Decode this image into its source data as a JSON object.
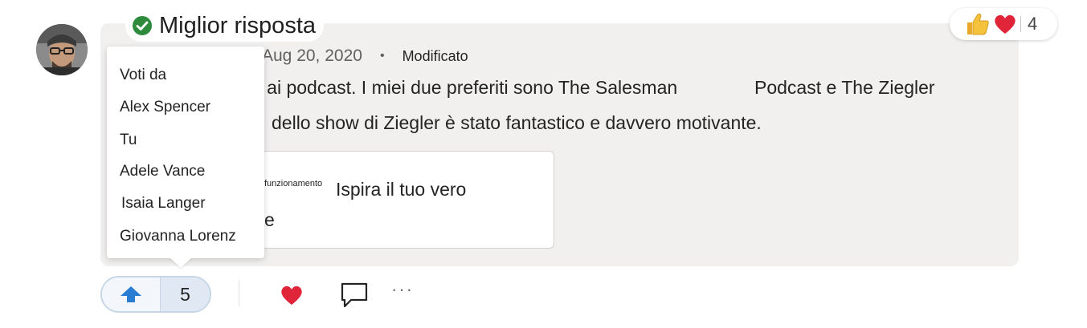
{
  "post": {
    "best_answer_label": "Miglior risposta",
    "date": "Aug 20, 2020",
    "separator": "•",
    "edited_label": "Modificato",
    "body_line1_left": "g ai podcast. I miei due preferiti sono The Salesman",
    "body_line1_right": "Podcast e The Ziegler",
    "body_line2": "dello show di Ziegler è stato fantastico e davvero motivante.",
    "link_card": {
      "small_text": "funzionamento",
      "title_line1": "Ispira il tuo vero",
      "title_line2": "e"
    }
  },
  "reactions": {
    "count": "4",
    "icons": [
      "thumbs-up-icon",
      "heart-icon"
    ]
  },
  "voters_popup": {
    "header": "Voti da",
    "names": [
      "Alex Spencer",
      "Tu",
      "Adele Vance",
      "Isaia Langer",
      "Giovanna  Lorenz"
    ]
  },
  "actions": {
    "upvote_count": "5",
    "more_label": "···"
  },
  "colors": {
    "upvote_blue": "#2b7cd3",
    "heart_red": "#e0243a",
    "check_green": "#2e8b3d",
    "card_bg": "#f1f0ef"
  }
}
